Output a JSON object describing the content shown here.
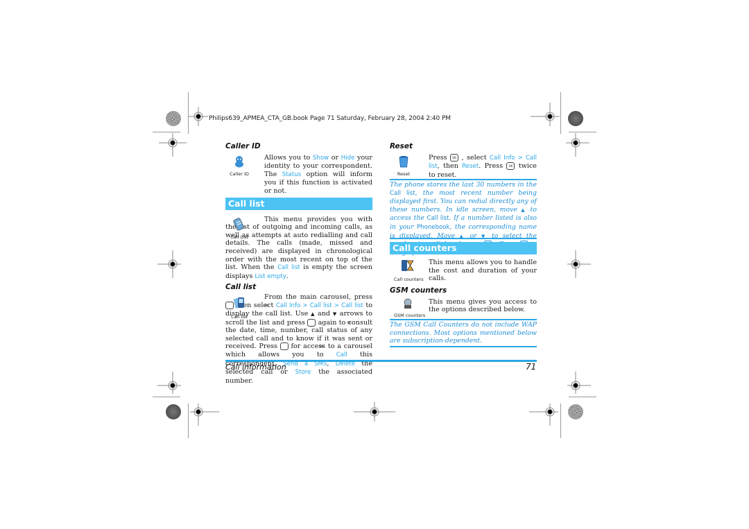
{
  "header": {
    "file_info": "Philips639_APMEA_CTA_GB.book  Page 71  Saturday, February 28, 2004  2:40 PM"
  },
  "left": {
    "caller_id": {
      "title": "Caller ID",
      "icon_caption": "Caller ID",
      "t1": "Allows you to ",
      "show": "Show",
      "t2": " or ",
      "hide": "Hide",
      "t3": " your identity to your correspondent. The ",
      "status": "Status",
      "t4": " option will inform you if this function is activated or not."
    },
    "call_list_section": {
      "title": "Call list",
      "icon_caption": "Call List",
      "t1": "This menu provides you with the list of outgoing and incoming calls, as well as attempts at auto redialling and call details. The calls (made, missed and received) are displayed in chronological order with the most recent on top of the list. When the ",
      "call_list": "Call list",
      "t2": " is empty the screen displays ",
      "list_empty": "List empty",
      "t3": "."
    },
    "call_list_sub": {
      "title": "Call list",
      "icon_caption": "Call list",
      "t1": "From the main carousel, press ",
      "t2": " then select ",
      "call_info": "Call Info",
      "sep": " > ",
      "call_list_a": "Call list",
      "call_list_b": "Call list",
      "t3": " to display the call list. Use ",
      "t4": " and ",
      "t5": " arrows to scroll the list and press ",
      "t6": " again to consult the date, time, number, call status of any selected call and to know if it was sent or received. Press ",
      "t7": " for access to a carousel which allows you to ",
      "call": "Call",
      "t8": " this correspondent, ",
      "send_sms": "Send a SMS",
      "t9": ", ",
      "delete": "Delete",
      "t10": " the selected call or ",
      "store": "Store",
      "t11": " the associated number."
    }
  },
  "right": {
    "reset": {
      "title": "Reset",
      "icon_caption": "Reset",
      "t1": "Press ",
      "t2": " , select ",
      "call_info": "Call Info",
      "sep": " > ",
      "call_list": "Call list",
      "t3": ", then ",
      "reset": "Reset",
      "t4": ". Press ",
      "t5": " twice to reset."
    },
    "note1": {
      "t1": "The phone stores the last 30 numbers in the ",
      "call_list_a": "Call list",
      "t2": ", the most recent number being displayed first. You can redial directly any of these numbers. In idle screen, move ",
      "t3": " to access the ",
      "call_list_b": "Call list",
      "t4": ". If a number listed is also in your ",
      "phonebook": "Phonebook",
      "t5": ", the corresponding name is displayed. Move ",
      "t6": " or ",
      "t7": " to select the number to redial and press ",
      "t8": " . Press ",
      "t9": " to hang up."
    },
    "call_counters": {
      "title": "Call counters",
      "icon_caption": "Call counters",
      "text": "This menu allows you to handle the cost and duration of your calls."
    },
    "gsm_counters": {
      "title": "GSM counters",
      "icon_caption": "GSM counters",
      "text": "This menu gives you access to the options described below."
    },
    "note2": {
      "text": "The GSM Call Counters do not include WAP connections. Most options mentioned below are subscription-dependent."
    }
  },
  "footer": {
    "section": "Call information",
    "page_number": "71"
  },
  "symbols": {
    "ok": "OK",
    "up": "▲",
    "down": "▼"
  },
  "colors": {
    "accent": "#4cc3f2",
    "link": "#2aa7e6",
    "note": "#1f8fd6"
  }
}
